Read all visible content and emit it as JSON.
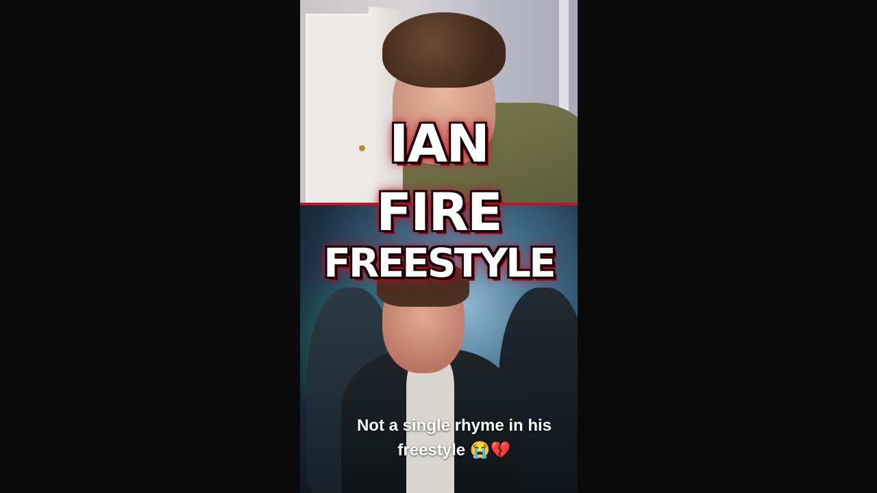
{
  "video": {
    "title_lines": [
      "IAN",
      "FIRE",
      "FREESTYLE"
    ],
    "caption_line1": "Not a single rhyme in his",
    "caption_line2": "freestyle 😭💔"
  },
  "colors": {
    "background": "#0a0a0b",
    "title_glow": "#c4122a",
    "text": "#ffffff"
  }
}
